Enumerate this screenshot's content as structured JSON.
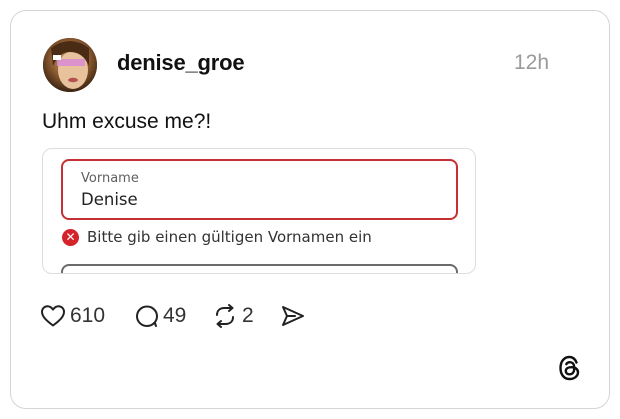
{
  "post": {
    "username": "denise_groe",
    "time": "12h",
    "text": "Uhm excuse me?!"
  },
  "embedded_screenshot": {
    "field_label": "Vorname",
    "field_value": "Denise",
    "error_icon": "x-circle-icon",
    "error_message": "Bitte gib einen gültigen Vornamen ein",
    "error_color": "#c62f34"
  },
  "actions": {
    "likes": "610",
    "replies": "49",
    "reposts": "2"
  },
  "icons": [
    "heart-icon",
    "comment-icon",
    "repost-icon",
    "share-icon",
    "threads-logo-icon"
  ]
}
